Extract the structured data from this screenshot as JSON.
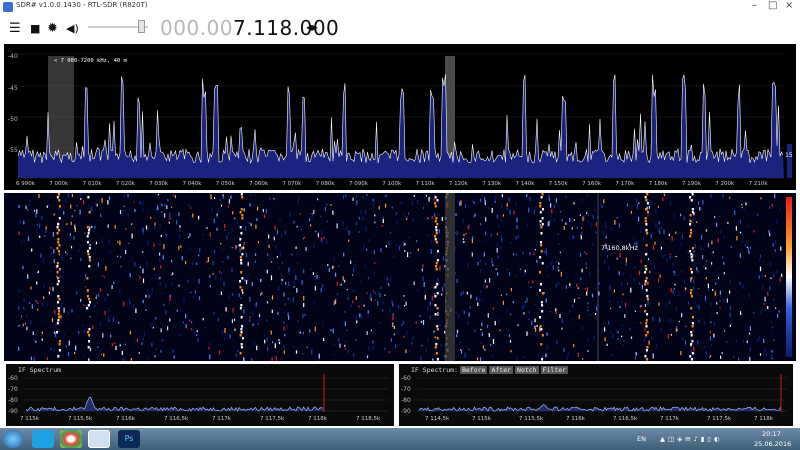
{
  "window": {
    "title": "SDR# v1.0.0.1430 - RTL-SDR (R820T)"
  },
  "toolbar": {
    "freq_dim": "000.00",
    "freq_bright": "7.118.000",
    "arrows": "◂▸"
  },
  "spectrum": {
    "band_label": "< 7 000-7200 kHz, 40 m",
    "y_ticks": [
      "-40",
      "-45",
      "-50",
      "-55"
    ],
    "x_ticks": [
      "6 990k",
      "7 000k",
      "7 010k",
      "7 020k",
      "7 030k",
      "7 040k",
      "7 050k",
      "7 060k",
      "7 070k",
      "7 080k",
      "7 090k",
      "7 100k",
      "7 110k",
      "7 120k",
      "7 130k",
      "7 140k",
      "7 150k",
      "7 160k",
      "7 170k",
      "7 180k",
      "7 190k",
      "7 200k",
      "7 210k"
    ],
    "side_value": "15"
  },
  "waterfall": {
    "cursor_label": "7 160,8kHz"
  },
  "if_left": {
    "title": "IF Spectrum",
    "y_ticks": [
      "-60",
      "-70",
      "-80",
      "-90"
    ],
    "x_ticks": [
      "7 115k",
      "7 115,5k",
      "7 116k",
      "7 116,5k",
      "7 117k",
      "7 117,5k",
      "7 118k",
      "7 118,5k"
    ]
  },
  "if_right": {
    "title": "IF Spectrum:",
    "modes": [
      "Before",
      "After",
      "Notch",
      "Filter"
    ],
    "y_ticks": [
      "-60",
      "-70",
      "-80",
      "-90"
    ],
    "x_ticks": [
      "7 114,5k",
      "7 115k",
      "7 115,5k",
      "7 116k",
      "7 116,5k",
      "7 117k",
      "7 117,5k",
      "7 118k"
    ]
  },
  "taskbar": {
    "language": "EN",
    "time": "20:17",
    "date": "25.06.2016"
  },
  "colors": {
    "spectrum_fill": "#1a237e",
    "trace": "#ffffff",
    "filter_band": "#4a4a4a",
    "if_trace": "#9fb6ff",
    "marker": "#ff2020"
  },
  "icons": {
    "menu": "menu-icon",
    "stop": "stop-icon",
    "settings": "gear-icon",
    "audio": "speaker-icon"
  }
}
